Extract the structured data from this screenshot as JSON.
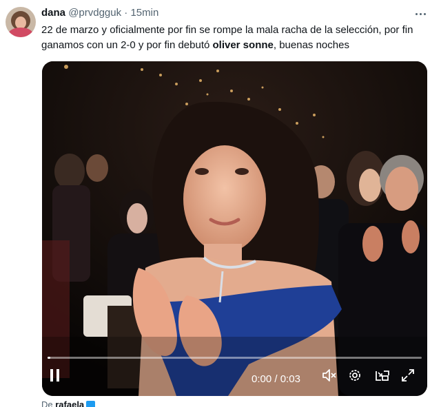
{
  "tweet": {
    "author_name": "dana",
    "handle": "@prvdgguk",
    "separator": "·",
    "time": "15min",
    "text_part1": "22 de marzo y oficialmente por fin se rompe la mala racha de la selección, por fin ganamos con un 2-0 y por fin debutó ",
    "text_bold": "oliver sonne",
    "text_part2": ", buenas noches"
  },
  "video": {
    "current_time": "0:00",
    "time_separator": " / ",
    "duration": "0:03",
    "progress": 0.008
  },
  "footer": {
    "prefix": "De ",
    "source_user": "rafaela"
  },
  "icons": [
    "more-icon",
    "pause-icon",
    "mute-icon",
    "settings-icon",
    "pip-icon",
    "fullscreen-icon",
    "verified-icon"
  ],
  "colors": {
    "text": "#0f1419",
    "secondary": "#536471",
    "verified": "#1d9bf0",
    "dress": "#1f3f96"
  }
}
